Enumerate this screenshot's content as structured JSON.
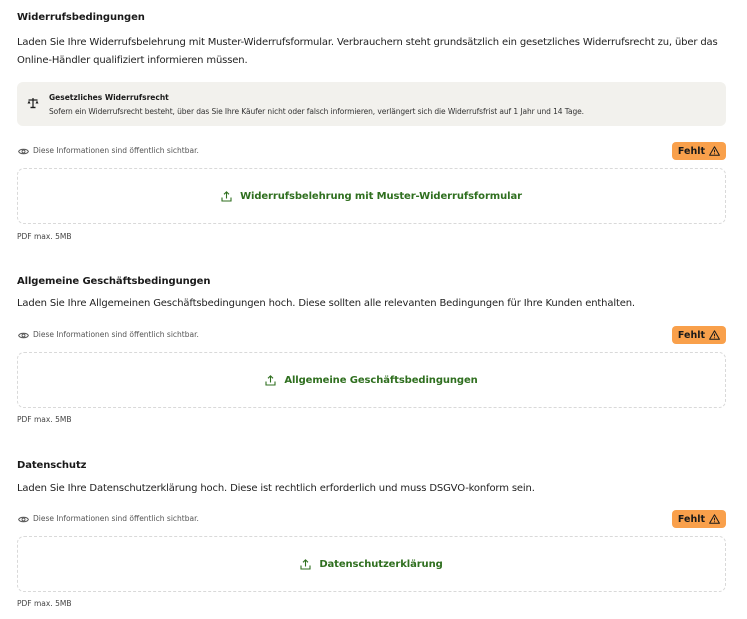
{
  "common": {
    "visibility_text": "Diese Informationen sind öffentlich sichtbar.",
    "badge_label": "Fehlt",
    "hint_text": "PDF max. 5MB",
    "accent_color": "#2f6f1f",
    "badge_color": "#f9a04b",
    "icons": [
      "eye-icon",
      "warning-icon",
      "upload-icon",
      "scale-icon"
    ]
  },
  "sections": [
    {
      "title": "Widerrufsbedingungen",
      "description": "Laden Sie Ihre Widerrufsbelehrung mit Muster-Widerrufsformular. Verbrauchern steht grundsätzlich ein gesetzliches Widerrufsrecht zu, über das Online-Händler qualifiziert informieren müssen.",
      "notice": {
        "title": "Gesetzliches Widerrufsrecht",
        "text": "Sofern ein Widerrufsrecht besteht, über das Sie Ihre Käufer nicht oder falsch informieren, verlängert sich die Widerrufsfrist auf 1 Jahr und 14 Tage."
      },
      "upload_label": "Widerrufsbelehrung mit Muster-Widerrufsformular"
    },
    {
      "title": "Allgemeine Geschäftsbedingungen",
      "description": "Laden Sie Ihre Allgemeinen Geschäftsbedingungen hoch. Diese sollten alle relevanten Bedingungen für Ihre Kunden enthalten.",
      "upload_label": "Allgemeine Geschäftsbedingungen"
    },
    {
      "title": "Datenschutz",
      "description": "Laden Sie Ihre Datenschutzerklärung hoch. Diese ist rechtlich erforderlich und muss DSGVO-konform sein.",
      "upload_label": "Datenschutzerklärung"
    }
  ]
}
